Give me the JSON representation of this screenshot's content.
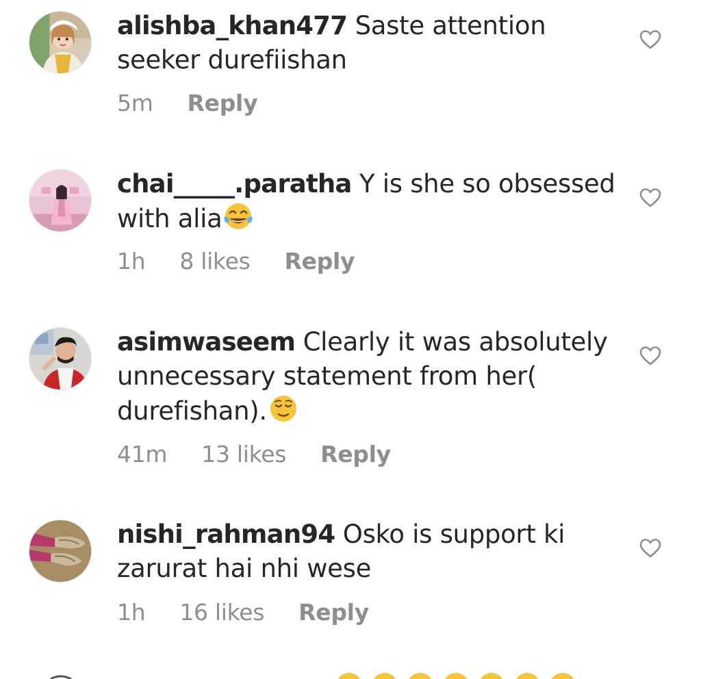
{
  "comments": [
    {
      "username": "alishba_khan477",
      "text": " Saste attention seeker durefiishan",
      "time": "5m",
      "likes": "",
      "reply_label": "Reply",
      "avatar_icon": "avatar-girl-photo"
    },
    {
      "username": "chai_____.paratha",
      "text": " Y is she so obsessed with alia",
      "emoji": "face-with-tears-of-joy",
      "time": "1h",
      "likes": "8 likes",
      "reply_label": "Reply",
      "avatar_icon": "avatar-pink-room-photo"
    },
    {
      "username": "asimwaseem",
      "text": " Clearly it was absolutely unnecessary statement from her( durefishan).",
      "emoji": "relieved-face",
      "time": "41m",
      "likes": "13 likes",
      "reply_label": "Reply",
      "avatar_icon": "avatar-man-photo"
    },
    {
      "username": "nishi_rahman94",
      "text": " Osko is support ki zarurat hai nhi wese",
      "time": "1h",
      "likes": "16 likes",
      "reply_label": "Reply",
      "avatar_icon": "avatar-shoes-photo"
    }
  ],
  "icons": {
    "like": "heart-outline-icon"
  },
  "colors": {
    "text": "#262626",
    "meta": "#8e8e8e",
    "heart": "#8e8e8e",
    "emoji": "#f7c33b"
  }
}
